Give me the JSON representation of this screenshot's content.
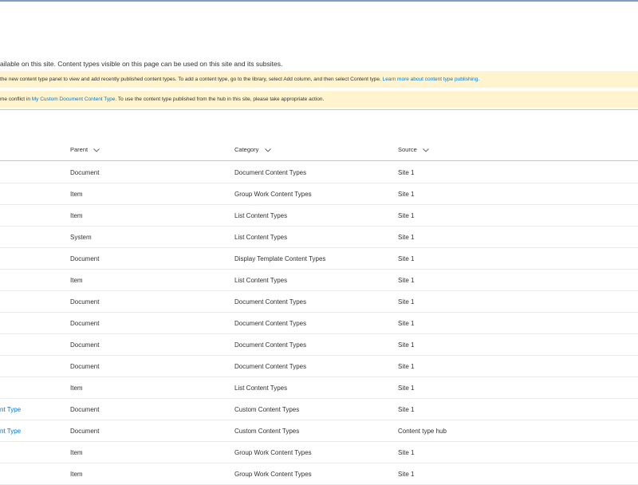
{
  "description": "ailable on this site. Content types visible on this page can be used on this site and its subsites.",
  "info_banner": {
    "text": "the new content type panel to view and add recently published content types. To add a content type, go to the library, select Add column, and then select Content type. ",
    "link": "Learn more about content type publishing."
  },
  "conflict_banner": {
    "prefix": "me conflict in ",
    "link": "My Custom Document Content Type",
    "suffix": ". To use the content type published from the hub in this site, please take appropriate action."
  },
  "columns": {
    "parent": "Parent",
    "category": "Category",
    "source": "Source"
  },
  "rows": [
    {
      "name": "",
      "parent": "Document",
      "category": "Document Content Types",
      "source": "Site 1"
    },
    {
      "name": "",
      "parent": "Item",
      "category": "Group Work Content Types",
      "source": "Site 1"
    },
    {
      "name": "",
      "parent": "Item",
      "category": "List Content Types",
      "source": "Site 1"
    },
    {
      "name": "",
      "parent": "System",
      "category": "List Content Types",
      "source": "Site 1"
    },
    {
      "name": "",
      "parent": "Document",
      "category": "Display Template Content Types",
      "source": "Site 1"
    },
    {
      "name": "",
      "parent": "Item",
      "category": "List Content Types",
      "source": "Site 1"
    },
    {
      "name": "",
      "parent": "Document",
      "category": "Document Content Types",
      "source": "Site 1"
    },
    {
      "name": "",
      "parent": "Document",
      "category": "Document Content Types",
      "source": "Site 1"
    },
    {
      "name": "",
      "parent": "Document",
      "category": "Document Content Types",
      "source": "Site 1"
    },
    {
      "name": "",
      "parent": "Document",
      "category": "Document Content Types",
      "source": "Site 1"
    },
    {
      "name": "",
      "parent": "Item",
      "category": "List Content Types",
      "source": "Site 1"
    },
    {
      "name": "nt Type",
      "parent": "Document",
      "category": "Custom Content Types",
      "source": "Site 1"
    },
    {
      "name": "nt Type",
      "parent": "Document",
      "category": "Custom Content Types",
      "source": "Content type hub"
    },
    {
      "name": "",
      "parent": "Item",
      "category": "Group Work Content Types",
      "source": "Site 1"
    },
    {
      "name": "",
      "parent": "Item",
      "category": "Group Work Content Types",
      "source": "Site 1"
    }
  ]
}
